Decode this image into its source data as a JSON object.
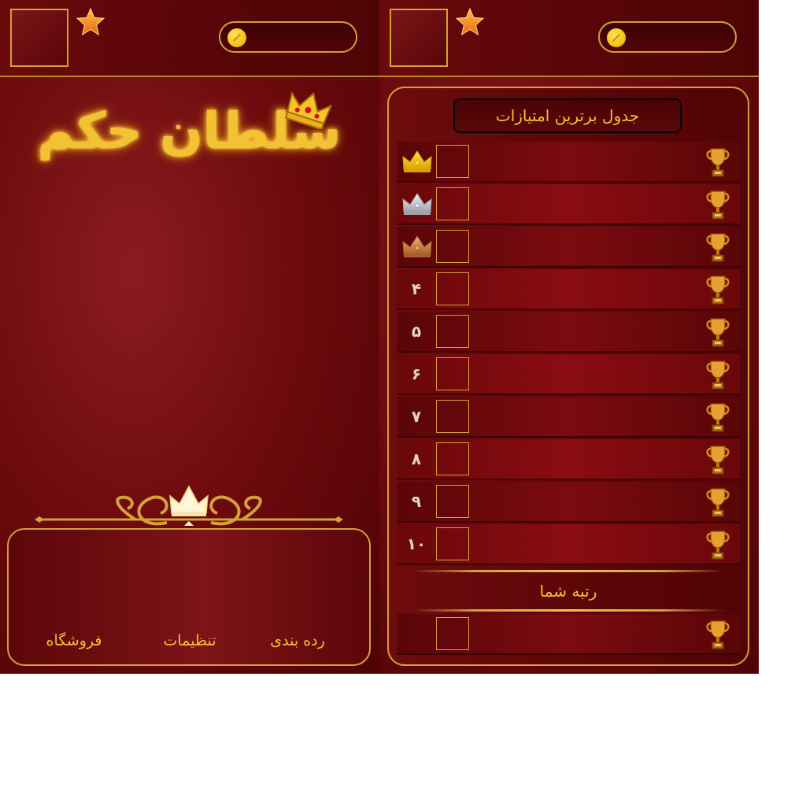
{
  "left_screen": {
    "logo_title": "سلطان حکم",
    "menu": {
      "shop": "فروشگاه",
      "settings": "تنظیمات",
      "ranking": "رده بندی"
    }
  },
  "right_screen": {
    "board_title": "جدول برترین امتیازات",
    "rows": [
      {
        "rank": "",
        "badge": "gold-crown"
      },
      {
        "rank": "",
        "badge": "silver-crown"
      },
      {
        "rank": "",
        "badge": "bronze-crown"
      },
      {
        "rank": "۴"
      },
      {
        "rank": "۵"
      },
      {
        "rank": "۶"
      },
      {
        "rank": "۷"
      },
      {
        "rank": "۸"
      },
      {
        "rank": "۹"
      },
      {
        "rank": "۱۰"
      }
    ],
    "your_rank_label": "رتبه شما"
  },
  "icons": {
    "star": "star-icon",
    "coin": "coin-icon",
    "trophy": "trophy-icon",
    "crown": "crown-icon"
  },
  "colors": {
    "accent_gold": "#d4a03a",
    "text_gold": "#f3c233",
    "background_red": "#6e0b0e"
  }
}
